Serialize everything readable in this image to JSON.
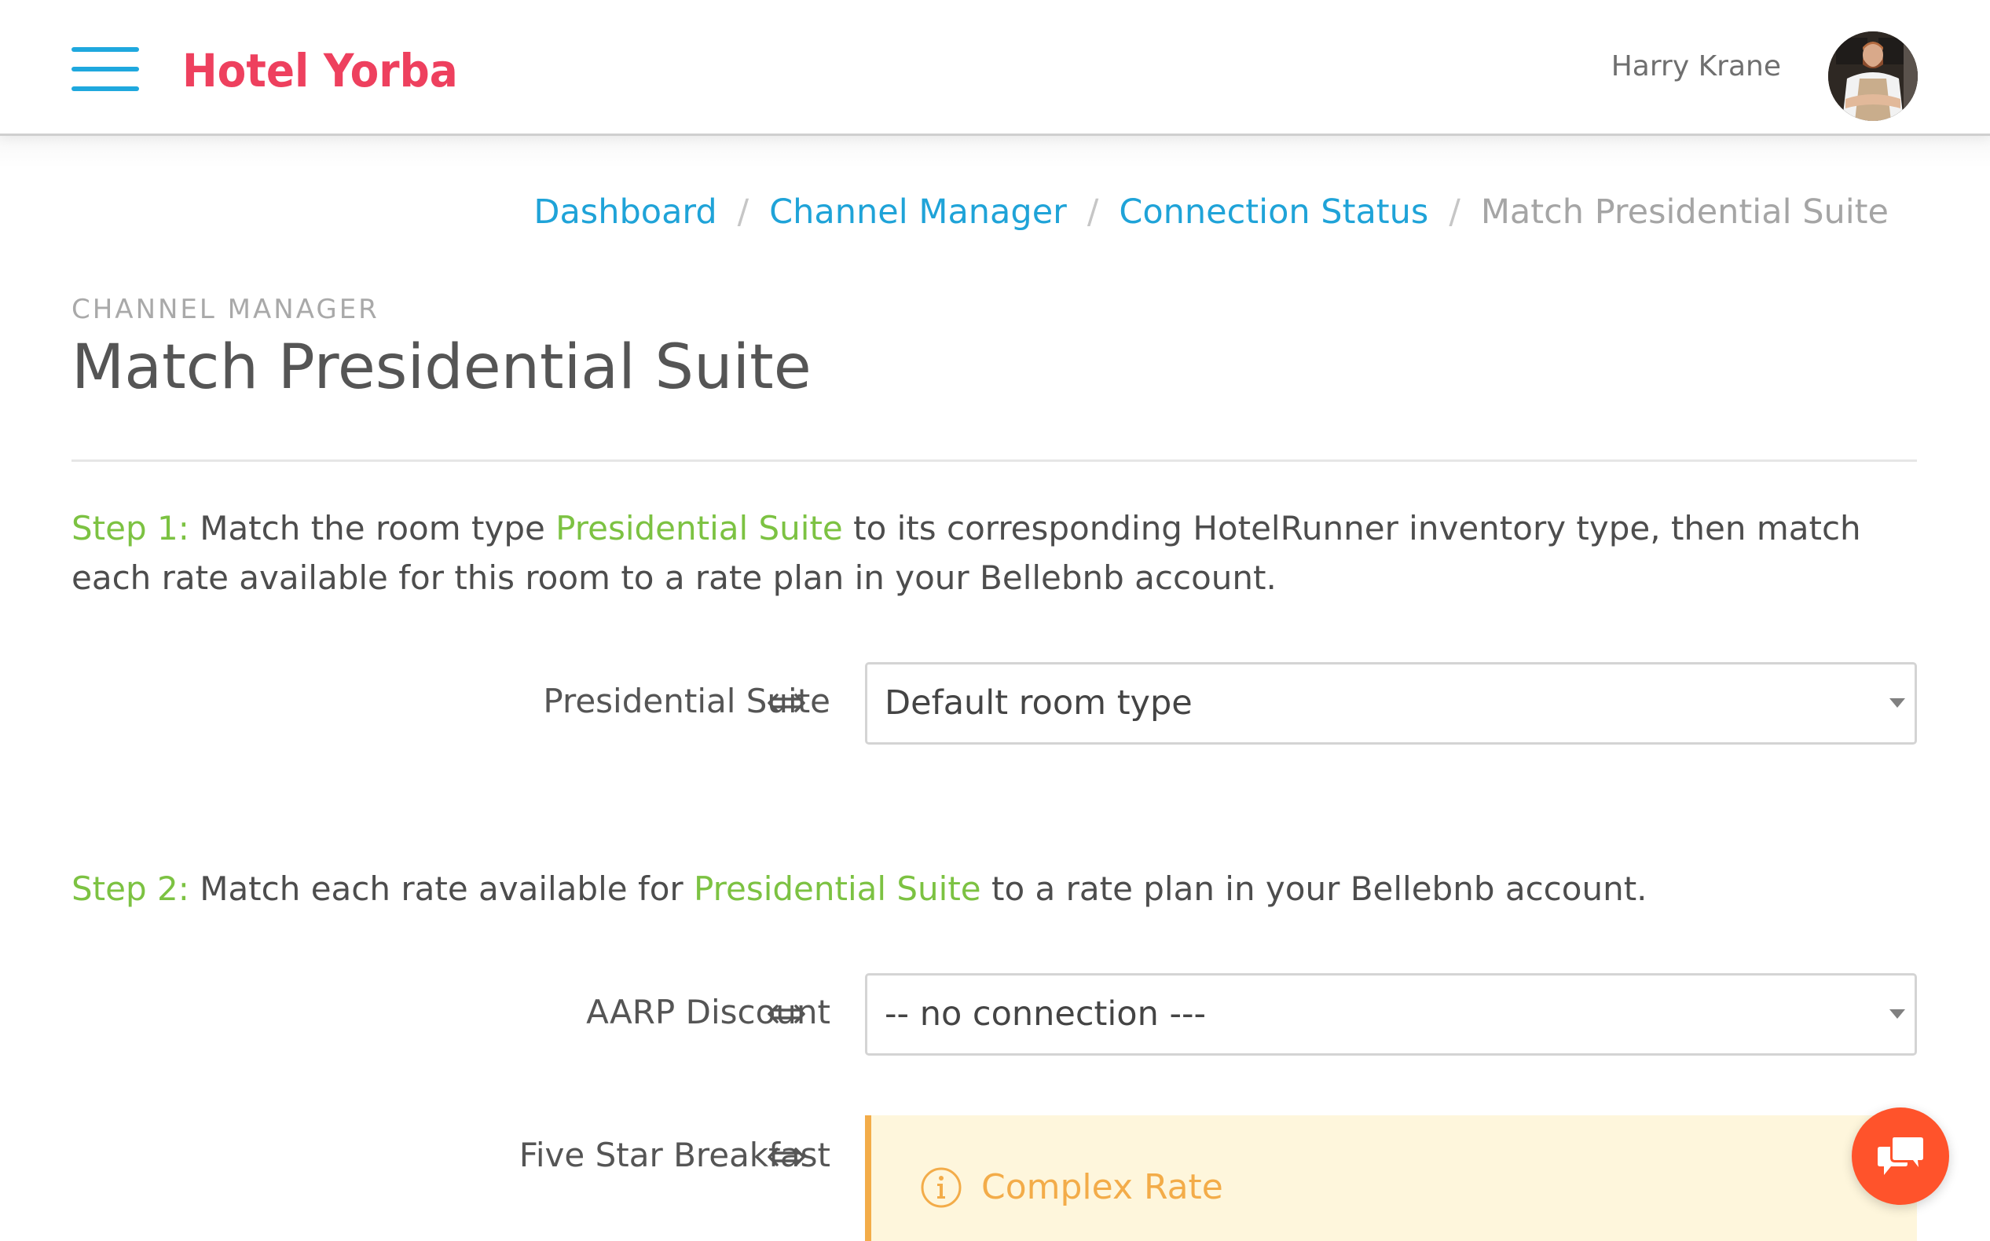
{
  "header": {
    "brand": "Hotel Yorba",
    "user_name": "Harry Krane",
    "menu_icon": "hamburger-menu-icon",
    "avatar_icon": "user-avatar"
  },
  "breadcrumb": {
    "items": [
      {
        "label": "Dashboard",
        "link": true
      },
      {
        "label": "Channel Manager",
        "link": true
      },
      {
        "label": "Connection Status",
        "link": true
      },
      {
        "label": "Match Presidential Suite",
        "link": false
      }
    ],
    "separator": "/"
  },
  "page": {
    "eyebrow": "CHANNEL MANAGER",
    "title": "Match Presidential Suite"
  },
  "step1": {
    "prefix": "Step 1:",
    "text_a": " Match the room type ",
    "highlight": "Presidential Suite",
    "text_b": " to its corresponding HotelRunner inventory type, then match each rate available for this room to a rate plan in your Bellebnb account."
  },
  "room_match": {
    "label": "Presidential Suite",
    "arrow_icon": "double-arrow-icon",
    "selected": "Default room type"
  },
  "step2": {
    "prefix": "Step 2:",
    "text_a": " Match each rate available for ",
    "highlight": "Presidential Suite",
    "text_b": " to a rate plan in your Bellebnb account."
  },
  "rates": [
    {
      "label": "AARP Discount",
      "selected": "-- no connection ---"
    },
    {
      "label": "Five Star Breakfast",
      "notice": "Complex Rate",
      "notice_icon": "info-icon"
    }
  ],
  "chat": {
    "icon": "chat-bubbles-icon"
  },
  "colors": {
    "brand": "#ee405e",
    "link": "#1fa3d8",
    "step_green": "#7cc242",
    "warning": "#f3ac49",
    "warning_bg": "#fef6dc",
    "fab": "#ff532b"
  }
}
